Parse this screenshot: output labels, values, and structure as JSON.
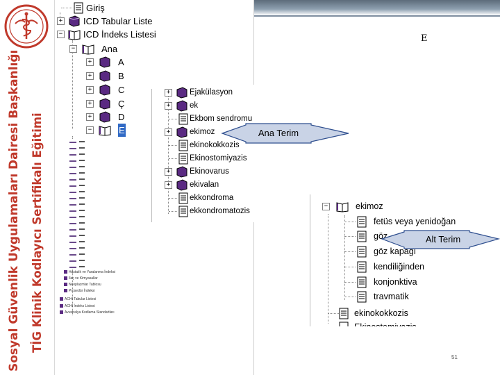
{
  "banner": {
    "line1": "Sosyal Güvenlik Uygulamaları Dairesi Başkanlığı",
    "line2": "TİG Klinik Kodlayıcı Sertifikalı Eğitimi"
  },
  "header": {
    "letter": "E"
  },
  "main_tree": {
    "items": [
      {
        "label": "Giriş"
      },
      {
        "label": "ICD Tabular Liste"
      },
      {
        "label": "ICD İndeks Listesi"
      },
      {
        "label": "Ana"
      },
      {
        "label": "A"
      },
      {
        "label": "B"
      },
      {
        "label": "C"
      },
      {
        "label": "Ç"
      },
      {
        "label": "D"
      },
      {
        "label": "E"
      }
    ],
    "tiny_items": [
      "Hastalık ve Yaralanma İndeksi",
      "İlaç ve Kimyasallar",
      "Neoplazmlar Tablosu",
      "Prosedür İndeksi",
      "ACHI Tabular Listesi",
      "ACHI İndeks Listesi",
      "Avustralya Kodlama Standartları"
    ]
  },
  "mid_tree": {
    "items": [
      {
        "label": "Ejakülasyon"
      },
      {
        "label": "ek"
      },
      {
        "label": "Ekbom sendromu"
      },
      {
        "label": "ekimoz"
      },
      {
        "label": "ekinokokkozis"
      },
      {
        "label": "Ekinostomiyazis"
      },
      {
        "label": "Ekinovarus"
      },
      {
        "label": "ekivalan"
      },
      {
        "label": "ekkondroma"
      },
      {
        "label": "ekkondromatozis"
      }
    ]
  },
  "right_tree": {
    "parent": "ekimoz",
    "children": [
      "fetüs veya yenidoğan",
      "göz",
      "göz kapağı",
      "kendiliğinden",
      "konjonktiva",
      "travmatik"
    ],
    "next": "ekinokokkozis",
    "next_partial": "Ekinostomiyazis"
  },
  "callouts": {
    "ana_terim": "Ana Terim",
    "alt_terim": "Alt Terim"
  },
  "page_number": "51",
  "colors": {
    "banner_text": "#c0392b",
    "book_icon": "#5a2a82",
    "callout_fill": "#c9d3e6",
    "selection": "#316ac5"
  }
}
